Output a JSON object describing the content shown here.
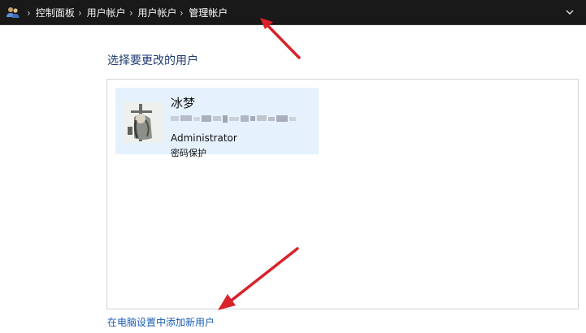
{
  "breadcrumb": {
    "items": [
      "控制面板",
      "用户帐户",
      "用户帐户",
      "管理帐户"
    ],
    "separator": "›"
  },
  "page": {
    "heading": "选择要更改的用户",
    "add_user_link": "在电脑设置中添加新用户"
  },
  "user": {
    "name": "冰梦",
    "role": "Administrator",
    "protection": "密码保护"
  },
  "colors": {
    "topbar": "#191919",
    "heading": "#1e3b70",
    "link": "#1a5cb4",
    "tile_bg": "#e5f2fd",
    "arrow": "#d9222a"
  },
  "icons": {
    "breadcrumb_icon": "users-icon",
    "dropdown": "chevron-down-icon"
  }
}
